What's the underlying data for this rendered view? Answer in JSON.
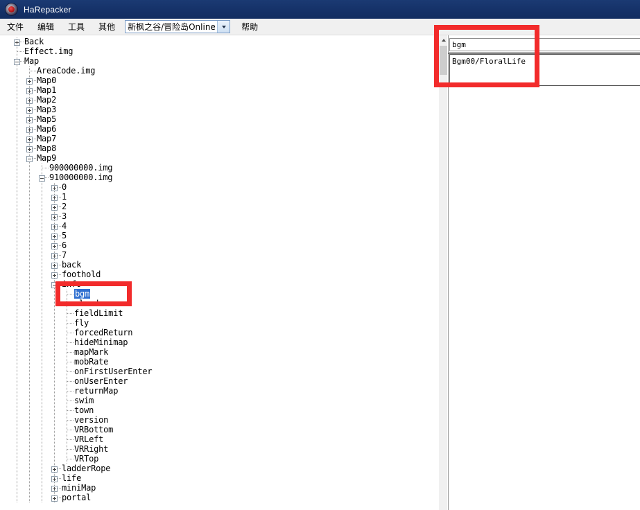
{
  "window": {
    "title": "HaRepacker",
    "icon": "harepacker-logo-icon"
  },
  "menubar": {
    "items": [
      {
        "label": "文件",
        "name": "menu-file"
      },
      {
        "label": "编辑",
        "name": "menu-edit"
      },
      {
        "label": "工具",
        "name": "menu-tools"
      },
      {
        "label": "其他",
        "name": "menu-other"
      }
    ],
    "combo": {
      "value": "新枫之谷/冒险岛Online",
      "arrow_icon": "chevron-down-icon"
    },
    "help_label": "帮助"
  },
  "tree": {
    "nodes": [
      {
        "label": "Back",
        "depth": 1,
        "toggle": "plus",
        "selected": false
      },
      {
        "label": "Effect.img",
        "depth": 1,
        "toggle": "none",
        "selected": false
      },
      {
        "label": "Map",
        "depth": 1,
        "toggle": "minus",
        "selected": false
      },
      {
        "label": "AreaCode.img",
        "depth": 2,
        "toggle": "none",
        "selected": false
      },
      {
        "label": "Map0",
        "depth": 2,
        "toggle": "plus",
        "selected": false
      },
      {
        "label": "Map1",
        "depth": 2,
        "toggle": "plus",
        "selected": false
      },
      {
        "label": "Map2",
        "depth": 2,
        "toggle": "plus",
        "selected": false
      },
      {
        "label": "Map3",
        "depth": 2,
        "toggle": "plus",
        "selected": false
      },
      {
        "label": "Map5",
        "depth": 2,
        "toggle": "plus",
        "selected": false
      },
      {
        "label": "Map6",
        "depth": 2,
        "toggle": "plus",
        "selected": false
      },
      {
        "label": "Map7",
        "depth": 2,
        "toggle": "plus",
        "selected": false
      },
      {
        "label": "Map8",
        "depth": 2,
        "toggle": "plus",
        "selected": false
      },
      {
        "label": "Map9",
        "depth": 2,
        "toggle": "minus",
        "selected": false
      },
      {
        "label": "900000000.img",
        "depth": 3,
        "toggle": "none",
        "selected": false
      },
      {
        "label": "910000000.img",
        "depth": 3,
        "toggle": "minus",
        "selected": false
      },
      {
        "label": "0",
        "depth": 4,
        "toggle": "plus",
        "selected": false
      },
      {
        "label": "1",
        "depth": 4,
        "toggle": "plus",
        "selected": false
      },
      {
        "label": "2",
        "depth": 4,
        "toggle": "plus",
        "selected": false
      },
      {
        "label": "3",
        "depth": 4,
        "toggle": "plus",
        "selected": false
      },
      {
        "label": "4",
        "depth": 4,
        "toggle": "plus",
        "selected": false
      },
      {
        "label": "5",
        "depth": 4,
        "toggle": "plus",
        "selected": false
      },
      {
        "label": "6",
        "depth": 4,
        "toggle": "plus",
        "selected": false
      },
      {
        "label": "7",
        "depth": 4,
        "toggle": "plus",
        "selected": false
      },
      {
        "label": "back",
        "depth": 4,
        "toggle": "plus",
        "selected": false
      },
      {
        "label": "foothold",
        "depth": 4,
        "toggle": "plus",
        "selected": false
      },
      {
        "label": "info",
        "depth": 4,
        "toggle": "minus",
        "selected": false
      },
      {
        "label": "bgm",
        "depth": 5,
        "toggle": "none",
        "selected": true
      },
      {
        "label": "cloud",
        "depth": 5,
        "toggle": "none",
        "selected": false
      },
      {
        "label": "fieldLimit",
        "depth": 5,
        "toggle": "none",
        "selected": false
      },
      {
        "label": "fly",
        "depth": 5,
        "toggle": "none",
        "selected": false
      },
      {
        "label": "forcedReturn",
        "depth": 5,
        "toggle": "none",
        "selected": false
      },
      {
        "label": "hideMinimap",
        "depth": 5,
        "toggle": "none",
        "selected": false
      },
      {
        "label": "mapMark",
        "depth": 5,
        "toggle": "none",
        "selected": false
      },
      {
        "label": "mobRate",
        "depth": 5,
        "toggle": "none",
        "selected": false
      },
      {
        "label": "onFirstUserEnter",
        "depth": 5,
        "toggle": "none",
        "selected": false
      },
      {
        "label": "onUserEnter",
        "depth": 5,
        "toggle": "none",
        "selected": false
      },
      {
        "label": "returnMap",
        "depth": 5,
        "toggle": "none",
        "selected": false
      },
      {
        "label": "swim",
        "depth": 5,
        "toggle": "none",
        "selected": false
      },
      {
        "label": "town",
        "depth": 5,
        "toggle": "none",
        "selected": false
      },
      {
        "label": "version",
        "depth": 5,
        "toggle": "none",
        "selected": false
      },
      {
        "label": "VRBottom",
        "depth": 5,
        "toggle": "none",
        "selected": false
      },
      {
        "label": "VRLeft",
        "depth": 5,
        "toggle": "none",
        "selected": false
      },
      {
        "label": "VRRight",
        "depth": 5,
        "toggle": "none",
        "selected": false
      },
      {
        "label": "VRTop",
        "depth": 5,
        "toggle": "none",
        "selected": false
      },
      {
        "label": "ladderRope",
        "depth": 4,
        "toggle": "plus",
        "selected": false
      },
      {
        "label": "life",
        "depth": 4,
        "toggle": "plus",
        "selected": false
      },
      {
        "label": "miniMap",
        "depth": 4,
        "toggle": "plus",
        "selected": false
      },
      {
        "label": "portal",
        "depth": 4,
        "toggle": "plus",
        "selected": false
      }
    ],
    "scrollbar": {
      "up_arrow_icon": "scroll-up-arrow-icon"
    }
  },
  "editor": {
    "name_value": "bgm",
    "value_value": "Bgm00/FloralLife"
  },
  "annotations": {
    "color": "#f22b2b",
    "boxes": [
      {
        "name": "annotation-tree-bgm"
      },
      {
        "name": "annotation-editor-fields"
      }
    ]
  }
}
